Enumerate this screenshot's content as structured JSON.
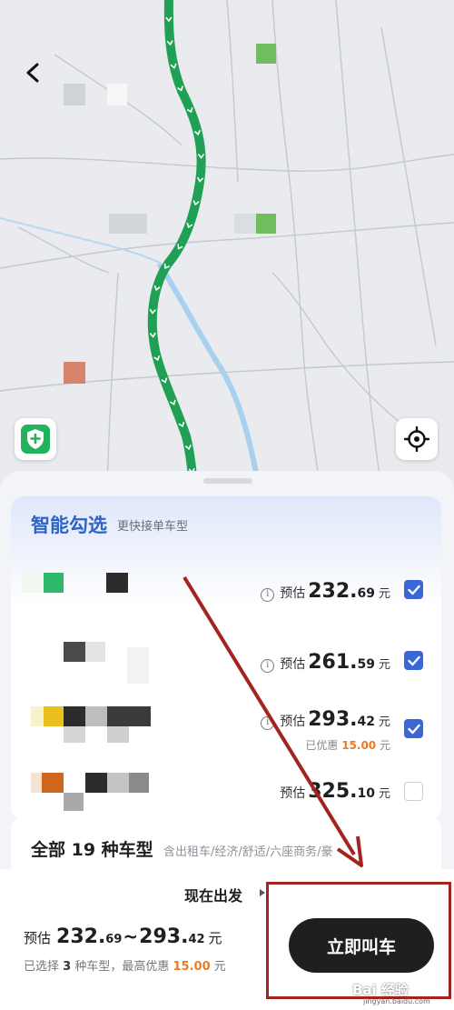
{
  "map": {
    "route_color": "#1fa055",
    "back_icon": "chevron-left-icon",
    "safety_icon": "shield-plus-icon",
    "locate_icon": "crosshair-icon"
  },
  "smart": {
    "title": "智能勾选",
    "subtitle": "更快接单车型",
    "rows": [
      {
        "prefix": "预估",
        "int": "232.",
        "dec": "69",
        "unit": "元",
        "checked": true,
        "discount": ""
      },
      {
        "prefix": "预估",
        "int": "261.",
        "dec": "59",
        "unit": "元",
        "checked": true,
        "discount": ""
      },
      {
        "prefix": "预估",
        "int": "293.",
        "dec": "42",
        "unit": "元",
        "checked": true,
        "discount": "已优惠",
        "discount_amount": "15.00",
        "discount_unit": "元"
      },
      {
        "prefix": "预估",
        "int": "325.",
        "dec": "10",
        "unit": "元",
        "checked": false,
        "discount": ""
      }
    ]
  },
  "all_types": {
    "title": "全部 19 种车型",
    "subtitle": "含出租车/经济/舒适/六座商务/豪"
  },
  "footer": {
    "depart_label": "现在出发",
    "est_prefix": "预估",
    "min_int": "232.",
    "min_dec": "69",
    "tilde": "~",
    "max_int": "293.",
    "max_dec": "42",
    "unit": "元",
    "selected_pre": "已选择",
    "selected_count": "3",
    "selected_mid": "种车型，最高优惠",
    "selected_amount": "15.00",
    "selected_unit": "元",
    "call_button": "立即叫车"
  },
  "watermark": {
    "text": "Bai 经验",
    "sub": "jingyan.baidu.com"
  },
  "colors": {
    "accent": "#3a66d6",
    "discount": "#ee7a23",
    "annotation": "#a3231e",
    "button": "#1f1f1f"
  }
}
